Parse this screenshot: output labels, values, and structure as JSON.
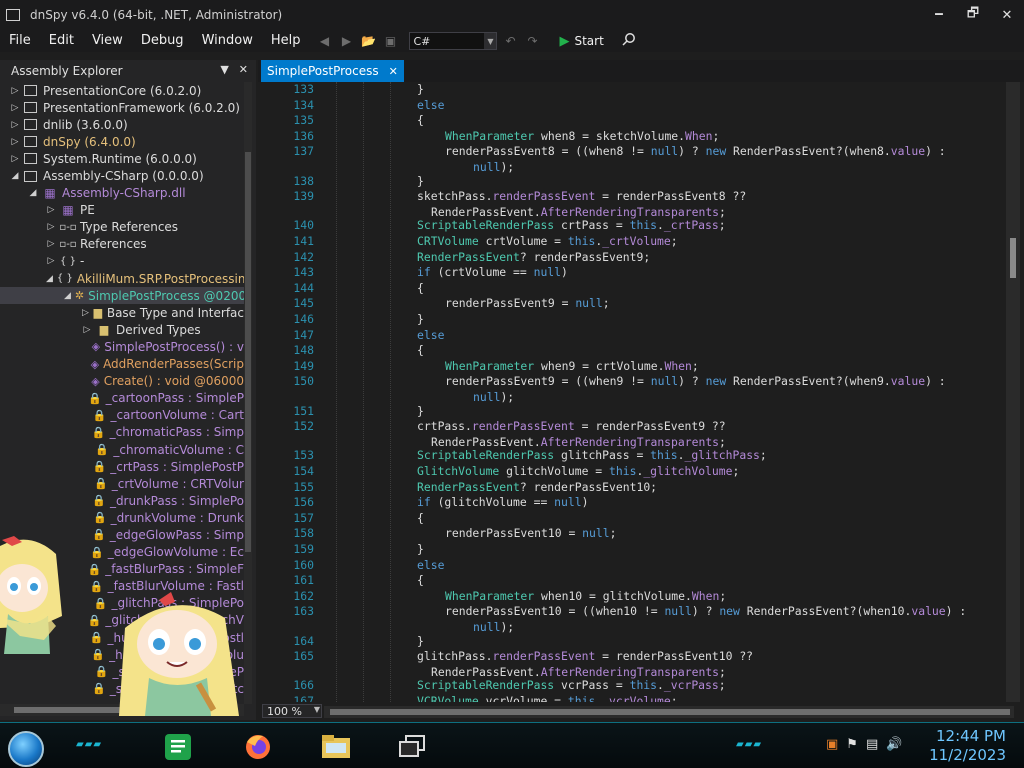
{
  "window": {
    "title": "dnSpy v6.4.0 (64-bit, .NET, Administrator)",
    "minimize": "🗕",
    "maximize": "🗗",
    "close": "✕"
  },
  "menu": [
    "File",
    "Edit",
    "View",
    "Debug",
    "Window",
    "Help"
  ],
  "toolbar": {
    "language": "C#",
    "start_label": "Start"
  },
  "explorer": {
    "title": "Assembly Explorer",
    "rows": [
      {
        "depth": 0,
        "exp": "▷",
        "icon": "assembly-icon",
        "label": "PresentationCore (6.0.2.0)",
        "color": "white"
      },
      {
        "depth": 0,
        "exp": "▷",
        "icon": "assembly-icon",
        "label": "PresentationFramework (6.0.2.0)",
        "color": "white"
      },
      {
        "depth": 0,
        "exp": "▷",
        "icon": "assembly-icon",
        "label": "dnlib (3.6.0.0)",
        "color": "white"
      },
      {
        "depth": 0,
        "exp": "▷",
        "icon": "assembly-icon",
        "label": "dnSpy (6.4.0.0)",
        "color": "yellow"
      },
      {
        "depth": 0,
        "exp": "▷",
        "icon": "assembly-icon",
        "label": "System.Runtime (6.0.0.0)",
        "color": "white"
      },
      {
        "depth": 0,
        "exp": "◢",
        "icon": "assembly-icon",
        "label": "Assembly-CSharp (0.0.0.0)",
        "color": "white"
      },
      {
        "depth": 1,
        "exp": "◢",
        "icon": "module-icon",
        "label": "Assembly-CSharp.dll",
        "color": "purple"
      },
      {
        "depth": 2,
        "exp": "▷",
        "icon": "pe-icon",
        "label": "PE",
        "color": "white"
      },
      {
        "depth": 2,
        "exp": "▷",
        "icon": "references-icon",
        "label": "Type References",
        "color": "white"
      },
      {
        "depth": 2,
        "exp": "▷",
        "icon": "references-icon",
        "label": "References",
        "color": "white"
      },
      {
        "depth": 2,
        "exp": "▷",
        "icon": "namespace-icon",
        "label": "-",
        "color": "white"
      },
      {
        "depth": 2,
        "exp": "◢",
        "icon": "namespace-icon",
        "label": "AkilliMum.SRP.PostProcessing",
        "color": "yellow"
      },
      {
        "depth": 3,
        "exp": "◢",
        "icon": "class-icon",
        "label": "SimplePostProcess @0200",
        "color": "type",
        "selected": true
      },
      {
        "depth": 4,
        "exp": "▷",
        "icon": "folder-icon",
        "label": "Base Type and Interfac",
        "color": "white"
      },
      {
        "depth": 4,
        "exp": "▷",
        "icon": "folder-icon",
        "label": "Derived Types",
        "color": "white"
      },
      {
        "depth": 4,
        "exp": "",
        "icon": "method-icon",
        "label": "SimplePostProcess() : v",
        "color": "purple"
      },
      {
        "depth": 4,
        "exp": "",
        "icon": "method-icon",
        "label": "AddRenderPasses(Scrip",
        "color": "orange"
      },
      {
        "depth": 4,
        "exp": "",
        "icon": "method-icon",
        "label": "Create() : void @06000",
        "color": "orange"
      },
      {
        "depth": 4,
        "exp": "",
        "icon": "field-icon",
        "label": "_cartoonPass : SimpleP",
        "color": "field"
      },
      {
        "depth": 4,
        "exp": "",
        "icon": "field-icon",
        "label": "_cartoonVolume : Cart",
        "color": "field"
      },
      {
        "depth": 4,
        "exp": "",
        "icon": "field-icon",
        "label": "_chromaticPass : Simp",
        "color": "field"
      },
      {
        "depth": 4,
        "exp": "",
        "icon": "field-icon",
        "label": "_chromaticVolume : C",
        "color": "field"
      },
      {
        "depth": 4,
        "exp": "",
        "icon": "field-icon",
        "label": "_crtPass : SimplePostP",
        "color": "field"
      },
      {
        "depth": 4,
        "exp": "",
        "icon": "field-icon",
        "label": "_crtVolume : CRTVolur",
        "color": "field"
      },
      {
        "depth": 4,
        "exp": "",
        "icon": "field-icon",
        "label": "_drunkPass : SimplePo",
        "color": "field"
      },
      {
        "depth": 4,
        "exp": "",
        "icon": "field-icon",
        "label": "_drunkVolume : Drunk",
        "color": "field"
      },
      {
        "depth": 4,
        "exp": "",
        "icon": "field-icon",
        "label": "_edgeGlowPass : Simp",
        "color": "field"
      },
      {
        "depth": 4,
        "exp": "",
        "icon": "field-icon",
        "label": "_edgeGlowVolume : Ec",
        "color": "field"
      },
      {
        "depth": 4,
        "exp": "",
        "icon": "field-icon",
        "label": "_fastBlurPass : SimpleF",
        "color": "field"
      },
      {
        "depth": 4,
        "exp": "",
        "icon": "field-icon",
        "label": "_fastBlurVolume : Fastl",
        "color": "field"
      },
      {
        "depth": 4,
        "exp": "",
        "icon": "field-icon",
        "label": "_glitchPass : SimplePo",
        "color": "field"
      },
      {
        "depth": 4,
        "exp": "",
        "icon": "field-icon",
        "label": "_glitchVolume : GlitchV",
        "color": "field"
      },
      {
        "depth": 4,
        "exp": "",
        "icon": "field-icon",
        "label": "_hudPass : SimplePostl",
        "color": "field"
      },
      {
        "depth": 4,
        "exp": "",
        "icon": "field-icon",
        "label": "_hudVolume : HudVolu",
        "color": "field"
      },
      {
        "depth": 4,
        "exp": "",
        "icon": "field-icon",
        "label": "_sketchPass : SimpleP",
        "color": "field"
      },
      {
        "depth": 4,
        "exp": "",
        "icon": "field-icon",
        "label": "_sketchVolume : Sketc",
        "color": "field"
      }
    ]
  },
  "editor": {
    "tab_label": "SimplePostProcess",
    "tab_close": "✕",
    "zoom": "100 %",
    "lines": [
      {
        "n": "133",
        "indent": 0,
        "parts": [
          [
            "p",
            "}"
          ]
        ]
      },
      {
        "n": "134",
        "indent": 0,
        "parts": [
          [
            "k",
            "else"
          ]
        ]
      },
      {
        "n": "135",
        "indent": 0,
        "parts": [
          [
            "p",
            "{"
          ]
        ]
      },
      {
        "n": "136",
        "indent": 1,
        "parts": [
          [
            "t",
            "WhenParameter"
          ],
          [
            "p",
            " when8 = sketchVolume."
          ],
          [
            "m",
            "When"
          ],
          [
            "p",
            ";"
          ]
        ]
      },
      {
        "n": "137",
        "indent": 1,
        "parts": [
          [
            "p",
            "renderPassEvent8 = ((when8 != "
          ],
          [
            "k",
            "null"
          ],
          [
            "p",
            ") ? "
          ],
          [
            "k",
            "new"
          ],
          [
            "p",
            " RenderPassEvent?(when8."
          ],
          [
            "m",
            "value"
          ],
          [
            "p",
            ") :"
          ]
        ]
      },
      {
        "n": "",
        "indent": 2,
        "parts": [
          [
            "k",
            "null"
          ],
          [
            "p",
            ");"
          ]
        ]
      },
      {
        "n": "138",
        "indent": 0,
        "parts": [
          [
            "p",
            "}"
          ]
        ]
      },
      {
        "n": "139",
        "indent": 0,
        "parts": [
          [
            "p",
            "sketchPass."
          ],
          [
            "m",
            "renderPassEvent"
          ],
          [
            "p",
            " = renderPassEvent8 ??"
          ]
        ]
      },
      {
        "n": "",
        "indent": 0.5,
        "parts": [
          [
            "p",
            "RenderPassEvent."
          ],
          [
            "m",
            "AfterRenderingTransparents"
          ],
          [
            "p",
            ";"
          ]
        ]
      },
      {
        "n": "140",
        "indent": 0,
        "parts": [
          [
            "t",
            "ScriptableRenderPass"
          ],
          [
            "p",
            " crtPass = "
          ],
          [
            "k",
            "this"
          ],
          [
            "p",
            "."
          ],
          [
            "m",
            "_crtPass"
          ],
          [
            "p",
            ";"
          ]
        ]
      },
      {
        "n": "141",
        "indent": 0,
        "parts": [
          [
            "t",
            "CRTVolume"
          ],
          [
            "p",
            " crtVolume = "
          ],
          [
            "k",
            "this"
          ],
          [
            "p",
            "."
          ],
          [
            "m",
            "_crtVolume"
          ],
          [
            "p",
            ";"
          ]
        ]
      },
      {
        "n": "142",
        "indent": 0,
        "parts": [
          [
            "t",
            "RenderPassEvent"
          ],
          [
            "p",
            "? renderPassEvent9;"
          ]
        ]
      },
      {
        "n": "143",
        "indent": 0,
        "parts": [
          [
            "k",
            "if"
          ],
          [
            "p",
            " (crtVolume == "
          ],
          [
            "k",
            "null"
          ],
          [
            "p",
            ")"
          ]
        ]
      },
      {
        "n": "144",
        "indent": 0,
        "parts": [
          [
            "p",
            "{"
          ]
        ]
      },
      {
        "n": "145",
        "indent": 1,
        "parts": [
          [
            "p",
            "renderPassEvent9 = "
          ],
          [
            "k",
            "null"
          ],
          [
            "p",
            ";"
          ]
        ]
      },
      {
        "n": "146",
        "indent": 0,
        "parts": [
          [
            "p",
            "}"
          ]
        ]
      },
      {
        "n": "147",
        "indent": 0,
        "parts": [
          [
            "k",
            "else"
          ]
        ]
      },
      {
        "n": "148",
        "indent": 0,
        "parts": [
          [
            "p",
            "{"
          ]
        ]
      },
      {
        "n": "149",
        "indent": 1,
        "parts": [
          [
            "t",
            "WhenParameter"
          ],
          [
            "p",
            " when9 = crtVolume."
          ],
          [
            "m",
            "When"
          ],
          [
            "p",
            ";"
          ]
        ]
      },
      {
        "n": "150",
        "indent": 1,
        "parts": [
          [
            "p",
            "renderPassEvent9 = ((when9 != "
          ],
          [
            "k",
            "null"
          ],
          [
            "p",
            ") ? "
          ],
          [
            "k",
            "new"
          ],
          [
            "p",
            " RenderPassEvent?(when9."
          ],
          [
            "m",
            "value"
          ],
          [
            "p",
            ") :"
          ]
        ]
      },
      {
        "n": "",
        "indent": 2,
        "parts": [
          [
            "k",
            "null"
          ],
          [
            "p",
            ");"
          ]
        ]
      },
      {
        "n": "151",
        "indent": 0,
        "parts": [
          [
            "p",
            "}"
          ]
        ]
      },
      {
        "n": "152",
        "indent": 0,
        "parts": [
          [
            "p",
            "crtPass."
          ],
          [
            "m",
            "renderPassEvent"
          ],
          [
            "p",
            " = renderPassEvent9 ??"
          ]
        ]
      },
      {
        "n": "",
        "indent": 0.5,
        "parts": [
          [
            "p",
            "RenderPassEvent."
          ],
          [
            "m",
            "AfterRenderingTransparents"
          ],
          [
            "p",
            ";"
          ]
        ]
      },
      {
        "n": "153",
        "indent": 0,
        "parts": [
          [
            "t",
            "ScriptableRenderPass"
          ],
          [
            "p",
            " glitchPass = "
          ],
          [
            "k",
            "this"
          ],
          [
            "p",
            "."
          ],
          [
            "m",
            "_glitchPass"
          ],
          [
            "p",
            ";"
          ]
        ]
      },
      {
        "n": "154",
        "indent": 0,
        "parts": [
          [
            "t",
            "GlitchVolume"
          ],
          [
            "p",
            " glitchVolume = "
          ],
          [
            "k",
            "this"
          ],
          [
            "p",
            "."
          ],
          [
            "m",
            "_glitchVolume"
          ],
          [
            "p",
            ";"
          ]
        ]
      },
      {
        "n": "155",
        "indent": 0,
        "parts": [
          [
            "t",
            "RenderPassEvent"
          ],
          [
            "p",
            "? renderPassEvent10;"
          ]
        ]
      },
      {
        "n": "156",
        "indent": 0,
        "parts": [
          [
            "k",
            "if"
          ],
          [
            "p",
            " (glitchVolume == "
          ],
          [
            "k",
            "null"
          ],
          [
            "p",
            ")"
          ]
        ]
      },
      {
        "n": "157",
        "indent": 0,
        "parts": [
          [
            "p",
            "{"
          ]
        ]
      },
      {
        "n": "158",
        "indent": 1,
        "parts": [
          [
            "p",
            "renderPassEvent10 = "
          ],
          [
            "k",
            "null"
          ],
          [
            "p",
            ";"
          ]
        ]
      },
      {
        "n": "159",
        "indent": 0,
        "parts": [
          [
            "p",
            "}"
          ]
        ]
      },
      {
        "n": "160",
        "indent": 0,
        "parts": [
          [
            "k",
            "else"
          ]
        ]
      },
      {
        "n": "161",
        "indent": 0,
        "parts": [
          [
            "p",
            "{"
          ]
        ]
      },
      {
        "n": "162",
        "indent": 1,
        "parts": [
          [
            "t",
            "WhenParameter"
          ],
          [
            "p",
            " when10 = glitchVolume."
          ],
          [
            "m",
            "When"
          ],
          [
            "p",
            ";"
          ]
        ]
      },
      {
        "n": "163",
        "indent": 1,
        "parts": [
          [
            "p",
            "renderPassEvent10 = ((when10 != "
          ],
          [
            "k",
            "null"
          ],
          [
            "p",
            ") ? "
          ],
          [
            "k",
            "new"
          ],
          [
            "p",
            " RenderPassEvent?(when10."
          ],
          [
            "m",
            "value"
          ],
          [
            "p",
            ") :"
          ]
        ]
      },
      {
        "n": "",
        "indent": 2,
        "parts": [
          [
            "k",
            "null"
          ],
          [
            "p",
            ");"
          ]
        ]
      },
      {
        "n": "164",
        "indent": 0,
        "parts": [
          [
            "p",
            "}"
          ]
        ]
      },
      {
        "n": "165",
        "indent": 0,
        "parts": [
          [
            "p",
            "glitchPass."
          ],
          [
            "m",
            "renderPassEvent"
          ],
          [
            "p",
            " = renderPassEvent10 ??"
          ]
        ]
      },
      {
        "n": "",
        "indent": 0.5,
        "parts": [
          [
            "p",
            "RenderPassEvent."
          ],
          [
            "m",
            "AfterRenderingTransparents"
          ],
          [
            "p",
            ";"
          ]
        ]
      },
      {
        "n": "166",
        "indent": 0,
        "parts": [
          [
            "t",
            "ScriptableRenderPass"
          ],
          [
            "p",
            " vcrPass = "
          ],
          [
            "k",
            "this"
          ],
          [
            "p",
            "."
          ],
          [
            "m",
            "_vcrPass"
          ],
          [
            "p",
            ";"
          ]
        ]
      },
      {
        "n": "167",
        "indent": 0,
        "parts": [
          [
            "t",
            "VCRVolume"
          ],
          [
            "p",
            " vcrVolume = "
          ],
          [
            "k",
            "this"
          ],
          [
            "p",
            "."
          ],
          [
            "m",
            "_vcrVolume"
          ],
          [
            "p",
            ";"
          ]
        ]
      }
    ]
  },
  "taskbar": {
    "time": "12:44 PM",
    "date": "11/2/2023"
  },
  "colors": {
    "accent": "#007acc",
    "keyword": "#569cd6",
    "type": "#4ec9b0",
    "member": "#b48ad8",
    "line_number": "#2b91af"
  }
}
